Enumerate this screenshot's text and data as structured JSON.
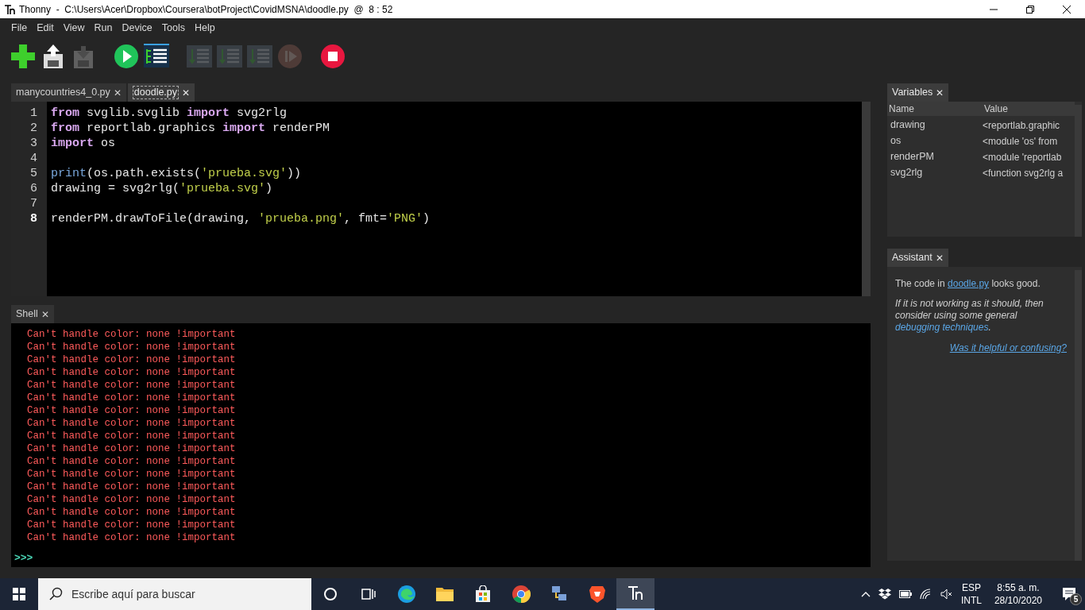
{
  "window": {
    "title": "Thonny  -  C:\\Users\\Acer\\Dropbox\\Coursera\\botProject\\CovidMSNA\\doodle.py  @  8 : 52"
  },
  "menu": [
    "File",
    "Edit",
    "View",
    "Run",
    "Device",
    "Tools",
    "Help"
  ],
  "toolbar": [
    {
      "kind": "new",
      "disabled": false
    },
    {
      "kind": "load",
      "disabled": false
    },
    {
      "kind": "save",
      "disabled": true
    },
    {
      "kind": "run",
      "disabled": false
    },
    {
      "kind": "debug",
      "disabled": false
    },
    {
      "kind": "step_over",
      "disabled": true
    },
    {
      "kind": "step_into",
      "disabled": true
    },
    {
      "kind": "step_out",
      "disabled": true
    },
    {
      "kind": "resume",
      "disabled": true
    },
    {
      "kind": "stop",
      "disabled": false
    }
  ],
  "editor_tabs": [
    {
      "label": "manycountries4_0.py",
      "close": "✕",
      "selected": false
    },
    {
      "label": "doodle.py",
      "close": "✕",
      "selected": true
    }
  ],
  "editor": {
    "lines": [
      {
        "number": "1",
        "current": false,
        "tokens": [
          {
            "kind": "keyword",
            "text": "from"
          },
          {
            "kind": "plain",
            "text": " svglib.svglib "
          },
          {
            "kind": "keyword",
            "text": "import"
          },
          {
            "kind": "plain",
            "text": " svg2rlg"
          }
        ]
      },
      {
        "number": "2",
        "current": false,
        "tokens": [
          {
            "kind": "keyword",
            "text": "from"
          },
          {
            "kind": "plain",
            "text": " reportlab.graphics "
          },
          {
            "kind": "keyword",
            "text": "import"
          },
          {
            "kind": "plain",
            "text": " renderPM"
          }
        ]
      },
      {
        "number": "3",
        "current": false,
        "tokens": [
          {
            "kind": "keyword",
            "text": "import"
          },
          {
            "kind": "plain",
            "text": " os"
          }
        ]
      },
      {
        "number": "4",
        "current": false
      },
      {
        "number": "5",
        "current": false,
        "tokens": [
          {
            "kind": "builtin",
            "text": "print"
          },
          {
            "kind": "plain",
            "text": "(os.path.exists("
          },
          {
            "kind": "string",
            "text": "'prueba.svg'"
          },
          {
            "kind": "plain",
            "text": "))"
          }
        ]
      },
      {
        "number": "6",
        "current": false,
        "tokens": [
          {
            "kind": "plain",
            "text": "drawing = svg2rlg("
          },
          {
            "kind": "string",
            "text": "'prueba.svg'"
          },
          {
            "kind": "plain",
            "text": ")"
          }
        ]
      },
      {
        "number": "7",
        "current": false
      },
      {
        "number": "8",
        "current": true,
        "tokens": [
          {
            "kind": "plain",
            "text": "renderPM.drawToFile(drawing, "
          },
          {
            "kind": "string",
            "text": "'prueba.png'"
          },
          {
            "kind": "plain",
            "text": ", fmt="
          },
          {
            "kind": "string",
            "text": "'PNG'"
          },
          {
            "kind": "plain",
            "text": ")"
          }
        ]
      }
    ]
  },
  "shell": {
    "tab": {
      "label": "Shell",
      "close": "✕"
    },
    "lines": [
      "Can't handle color: none !important",
      "Can't handle color: none !important",
      "Can't handle color: none !important",
      "Can't handle color: none !important",
      "Can't handle color: none !important",
      "Can't handle color: none !important",
      "Can't handle color: none !important",
      "Can't handle color: none !important",
      "Can't handle color: none !important",
      "Can't handle color: none !important",
      "Can't handle color: none !important",
      "Can't handle color: none !important",
      "Can't handle color: none !important",
      "Can't handle color: none !important",
      "Can't handle color: none !important",
      "Can't handle color: none !important",
      "Can't handle color: none !important"
    ],
    "prompt": ">>>"
  },
  "variables": {
    "tab": {
      "label": "Variables",
      "close": "✕"
    },
    "columns": [
      "Name",
      "Value"
    ],
    "rows": [
      {
        "name": "drawing",
        "value": "<reportlab.graphic"
      },
      {
        "name": "os",
        "value": "<module 'os' from"
      },
      {
        "name": "renderPM",
        "value": "<module 'reportlab"
      },
      {
        "name": "svg2rlg",
        "value": "<function svg2rlg a"
      }
    ]
  },
  "assistant": {
    "tab": {
      "label": "Assistant",
      "close": "✕"
    },
    "message": {
      "before": "The code in ",
      "link": "doodle.py",
      "after": " looks good."
    },
    "hint": {
      "before": "If it is not working as it should, then consider using some general ",
      "link": "debugging techniques",
      "after": "."
    },
    "feedback_link": "Was it helpful or confusing?"
  },
  "taskbar": {
    "search": {
      "placeholder": "Escribe aquí para buscar"
    },
    "apps": [
      {
        "kind": "cortana",
        "selected": false
      },
      {
        "kind": "task_view",
        "selected": false
      },
      {
        "kind": "edge",
        "selected": false
      },
      {
        "kind": "explorer",
        "selected": false
      },
      {
        "kind": "store",
        "selected": false
      },
      {
        "kind": "chrome",
        "selected": false
      },
      {
        "kind": "network",
        "selected": false
      },
      {
        "kind": "brave",
        "selected": false
      },
      {
        "kind": "thonny",
        "selected": true
      }
    ],
    "language": "ESP",
    "layout": "INTL",
    "time": "8:55 a. m.",
    "date": "28/10/2020",
    "notifications": "5"
  }
}
